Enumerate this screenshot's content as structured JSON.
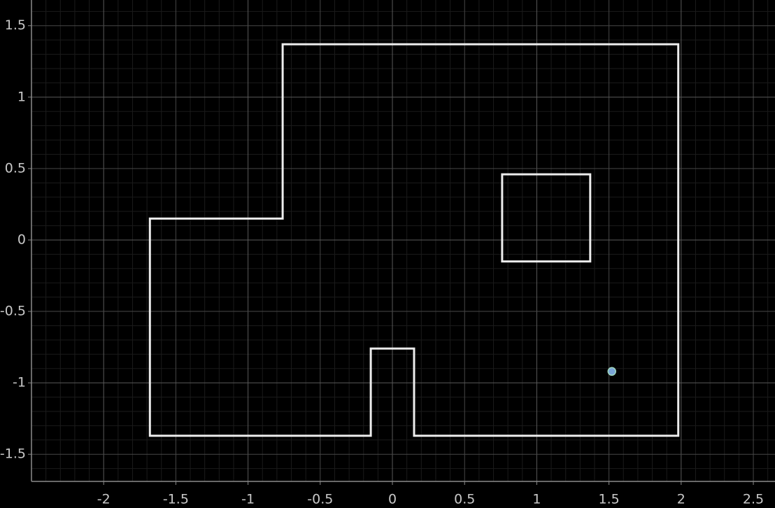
{
  "chart_data": {
    "type": "scatter",
    "title": "",
    "xlabel": "",
    "ylabel": "",
    "xlim": [
      -2.5,
      2.65
    ],
    "ylim": [
      -1.69,
      1.68
    ],
    "grid": true,
    "x_ticks": [
      {
        "value": -2,
        "label": "-2"
      },
      {
        "value": -1.5,
        "label": "-1.5"
      },
      {
        "value": -1,
        "label": "-1"
      },
      {
        "value": -0.5,
        "label": "-0.5"
      },
      {
        "value": 0,
        "label": "0"
      },
      {
        "value": 0.5,
        "label": "0.5"
      },
      {
        "value": 1,
        "label": "1"
      },
      {
        "value": 1.5,
        "label": "1.5"
      },
      {
        "value": 2,
        "label": "2"
      },
      {
        "value": 2.5,
        "label": "2.5"
      }
    ],
    "y_ticks": [
      {
        "value": 1.5,
        "label": "1.5"
      },
      {
        "value": 1,
        "label": "1"
      },
      {
        "value": 0.5,
        "label": "0.5"
      },
      {
        "value": 0,
        "label": "0"
      },
      {
        "value": -0.5,
        "label": "-0.5"
      },
      {
        "value": -1,
        "label": "-1"
      },
      {
        "value": -1.5,
        "label": "-1.5"
      }
    ],
    "polygons": [
      {
        "name": "outer-boundary",
        "points": [
          [
            -1.68,
            -1.37
          ],
          [
            -0.15,
            -1.37
          ],
          [
            -0.15,
            -0.76
          ],
          [
            0.15,
            -0.76
          ],
          [
            0.15,
            -1.37
          ],
          [
            1.98,
            -1.37
          ],
          [
            1.98,
            1.37
          ],
          [
            -0.76,
            1.37
          ],
          [
            -0.76,
            0.15
          ],
          [
            -1.68,
            0.15
          ]
        ]
      },
      {
        "name": "inner-obstacle",
        "points": [
          [
            0.76,
            -0.15
          ],
          [
            1.37,
            -0.15
          ],
          [
            1.37,
            0.46
          ],
          [
            0.76,
            0.46
          ]
        ]
      }
    ],
    "points": [
      {
        "x": 1.52,
        "y": -0.92
      }
    ],
    "colors": {
      "background": "#000000",
      "major_grid": "#474747",
      "minor_grid": "#1b1b1b",
      "axis_line": "#8a8a8a",
      "shape_stroke": "#ececec",
      "point_fill": "#7aa4d6",
      "point_stroke": "#9fd7bf",
      "tick_text": "#c8c8c8"
    }
  }
}
